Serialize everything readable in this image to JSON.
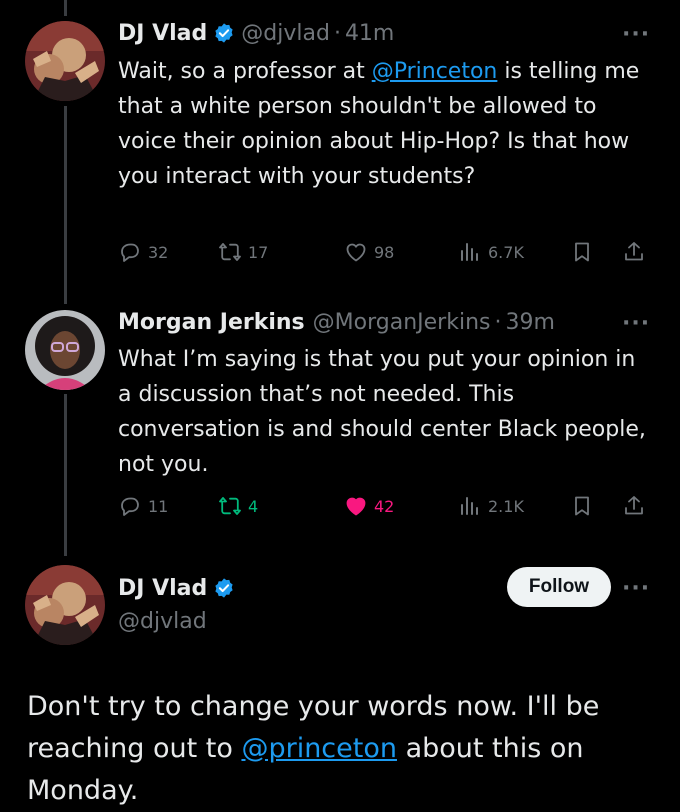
{
  "tweet1": {
    "name": "DJ Vlad",
    "handle": "@djvlad",
    "sep": "·",
    "time": "41m",
    "more": "···",
    "text_before": "Wait, so a professor at ",
    "mention": "@Princeton",
    "text_after": " is telling me that a white person shouldn't be allowed to voice their opinion about Hip-Hop? Is that how you interact with your students?",
    "replies": "32",
    "reposts": "17",
    "likes": "98",
    "views": "6.7K"
  },
  "tweet2": {
    "name": "Morgan Jerkins",
    "handle": "@MorganJerkins",
    "sep": "·",
    "time": "39m",
    "more": "···",
    "text": "What I’m saying is that you put your opinion in a discussion that’s not needed. This conversation is and should center Black people, not you.",
    "replies": "11",
    "reposts": "4",
    "likes": "42",
    "views": "2.1K",
    "repost_color": "#00ba7c",
    "like_color": "#f91880"
  },
  "tweet3": {
    "name": "DJ Vlad",
    "handle": "@djvlad",
    "follow_label": "Follow",
    "more": "···",
    "text_before": "Don't try to change your words now.  I'll be reaching out to ",
    "mention": "@princeton",
    "text_after": " about this on Monday."
  },
  "colors": {
    "accent": "#1d9bf0",
    "muted": "#71767b",
    "background": "#000000"
  },
  "icons": [
    "verified-badge-icon",
    "reply-icon",
    "repost-icon",
    "like-icon",
    "views-icon",
    "bookmark-icon",
    "share-icon",
    "more-icon"
  ]
}
